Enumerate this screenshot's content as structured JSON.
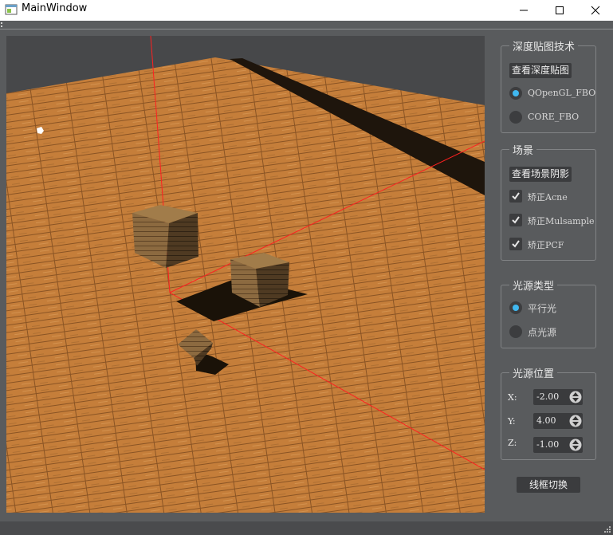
{
  "window": {
    "title": "MainWindow",
    "icon": "app-window-icon",
    "controls": [
      "minimize-icon",
      "maximize-icon",
      "close-icon"
    ]
  },
  "depth_group": {
    "title": "深度贴图技术",
    "view_button": "查看深度贴图",
    "options": [
      {
        "label": "QOpenGL_FBO",
        "checked": true
      },
      {
        "label": "CORE_FBO",
        "checked": false
      }
    ]
  },
  "scene_group": {
    "title": "场景",
    "view_button": "查看场景阴影",
    "checks": [
      {
        "label": "矫正Acne",
        "checked": true
      },
      {
        "label": "矫正Mulsample",
        "checked": true
      },
      {
        "label": "矫正PCF",
        "checked": true
      }
    ]
  },
  "light_type_group": {
    "title": "光源类型",
    "options": [
      {
        "label": "平行光",
        "checked": true
      },
      {
        "label": "点光源",
        "checked": false
      }
    ]
  },
  "light_pos_group": {
    "title": "光源位置",
    "fields": [
      {
        "axis": "X:",
        "value": "-2.00"
      },
      {
        "axis": "Y:",
        "value": "4.00"
      },
      {
        "axis": "Z:",
        "value": "-1.00"
      }
    ]
  },
  "wireframe_button": "线框切换",
  "colors": {
    "panel_bg": "#595b5d",
    "viewport_bg": "#47484a",
    "floor_wood": "#c57e3a",
    "axis_line": "#ff2020",
    "radio_accent": "#40b8f0"
  }
}
